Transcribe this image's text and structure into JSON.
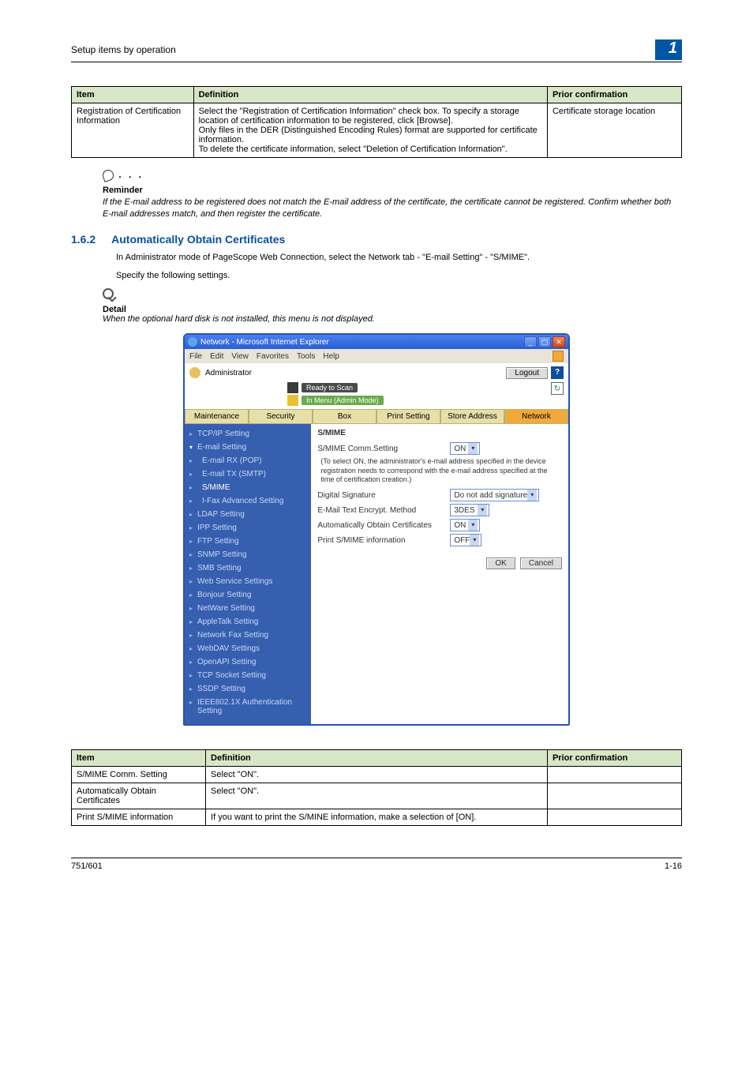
{
  "header": {
    "breadcrumb": "Setup items by operation",
    "chapter": "1"
  },
  "table1": {
    "cols": {
      "item": "Item",
      "definition": "Definition",
      "prior": "Prior confirmation"
    },
    "row": {
      "item": "Registration of Certification Information",
      "definition": "Select the \"Registration of Certification Information\" check box. To specify a storage location of certification information to be registered, click [Browse].\nOnly files in the DER (Distinguished Encoding Rules) format are supported for certificate information.\nTo delete the certificate information, select \"Deletion of Certification Information\".",
      "prior": "Certificate storage location"
    }
  },
  "reminder": {
    "title": "Reminder",
    "text": "If the E-mail address to be registered does not match the E-mail address of the certificate, the certificate cannot be registered. Confirm whether both E-mail addresses match, and then register the certificate."
  },
  "section": {
    "num": "1.6.2",
    "title": "Automatically Obtain Certificates"
  },
  "para1": "In Administrator mode of PageScope Web Connection, select the Network tab - \"E-mail Setting\" - \"S/MIME\".",
  "para2": "Specify the following settings.",
  "detail": {
    "title": "Detail",
    "text": "When the optional hard disk is not installed, this menu is not displayed."
  },
  "ss": {
    "window_title": "Network - Microsoft Internet Explorer",
    "menus": [
      "File",
      "Edit",
      "View",
      "Favorites",
      "Tools",
      "Help"
    ],
    "admin_label": "Administrator",
    "logout": "Logout",
    "help": "?",
    "status1": "Ready to Scan",
    "status2": "In Menu (Admin Mode)",
    "refresh": "↻",
    "tabs": [
      "Maintenance",
      "Security",
      "Box",
      "Print Setting",
      "Store Address",
      "Network"
    ],
    "side": {
      "tcpip": "TCP/IP Setting",
      "email": "E-mail Setting",
      "erx": "E-mail RX (POP)",
      "etx": "E-mail TX (SMTP)",
      "smime": "S/MIME",
      "ifax": "I-Fax Advanced Setting",
      "ldap": "LDAP Setting",
      "ipp": "IPP Setting",
      "ftp": "FTP Setting",
      "snmp": "SNMP Setting",
      "smb": "SMB Setting",
      "websvc": "Web Service Settings",
      "bonjour": "Bonjour Setting",
      "netware": "NetWare Setting",
      "appletalk": "AppleTalk Setting",
      "netfax": "Network Fax Setting",
      "webdav": "WebDAV Settings",
      "openapi": "OpenAPI Setting",
      "tcpsock": "TCP Socket Setting",
      "ssdp": "SSDP Setting",
      "ieee": "IEEE802.1X Authentication Setting"
    },
    "panel": {
      "heading": "S/MIME",
      "row1": {
        "label": "S/MIME Comm.Setting",
        "value": "ON"
      },
      "note": "(To select ON, the administrator's e-mail address specified in the device registration needs to correspond with the e-mail address specified at the time of certification creation.)",
      "row2": {
        "label": "Digital Signature",
        "value": "Do not add signature"
      },
      "row3": {
        "label": "E-Mail Text Encrypt. Method",
        "value": "3DES"
      },
      "row4": {
        "label": "Automatically Obtain Certificates",
        "value": "ON"
      },
      "row5": {
        "label": "Print S/MIME information",
        "value": "OFF"
      },
      "ok": "OK",
      "cancel": "Cancel"
    }
  },
  "table2": {
    "cols": {
      "item": "Item",
      "definition": "Definition",
      "prior": "Prior confirmation"
    },
    "rows": [
      {
        "item": "S/MIME Comm. Setting",
        "definition": "Select \"ON\".",
        "prior": ""
      },
      {
        "item": "Automatically Obtain Certificates",
        "definition": "Select \"ON\".",
        "prior": ""
      },
      {
        "item": "Print S/MIME information",
        "definition": "If you want to print the S/MINE information, make a selection of [ON].",
        "prior": ""
      }
    ]
  },
  "footer": {
    "left": "751/601",
    "right": "1-16"
  }
}
